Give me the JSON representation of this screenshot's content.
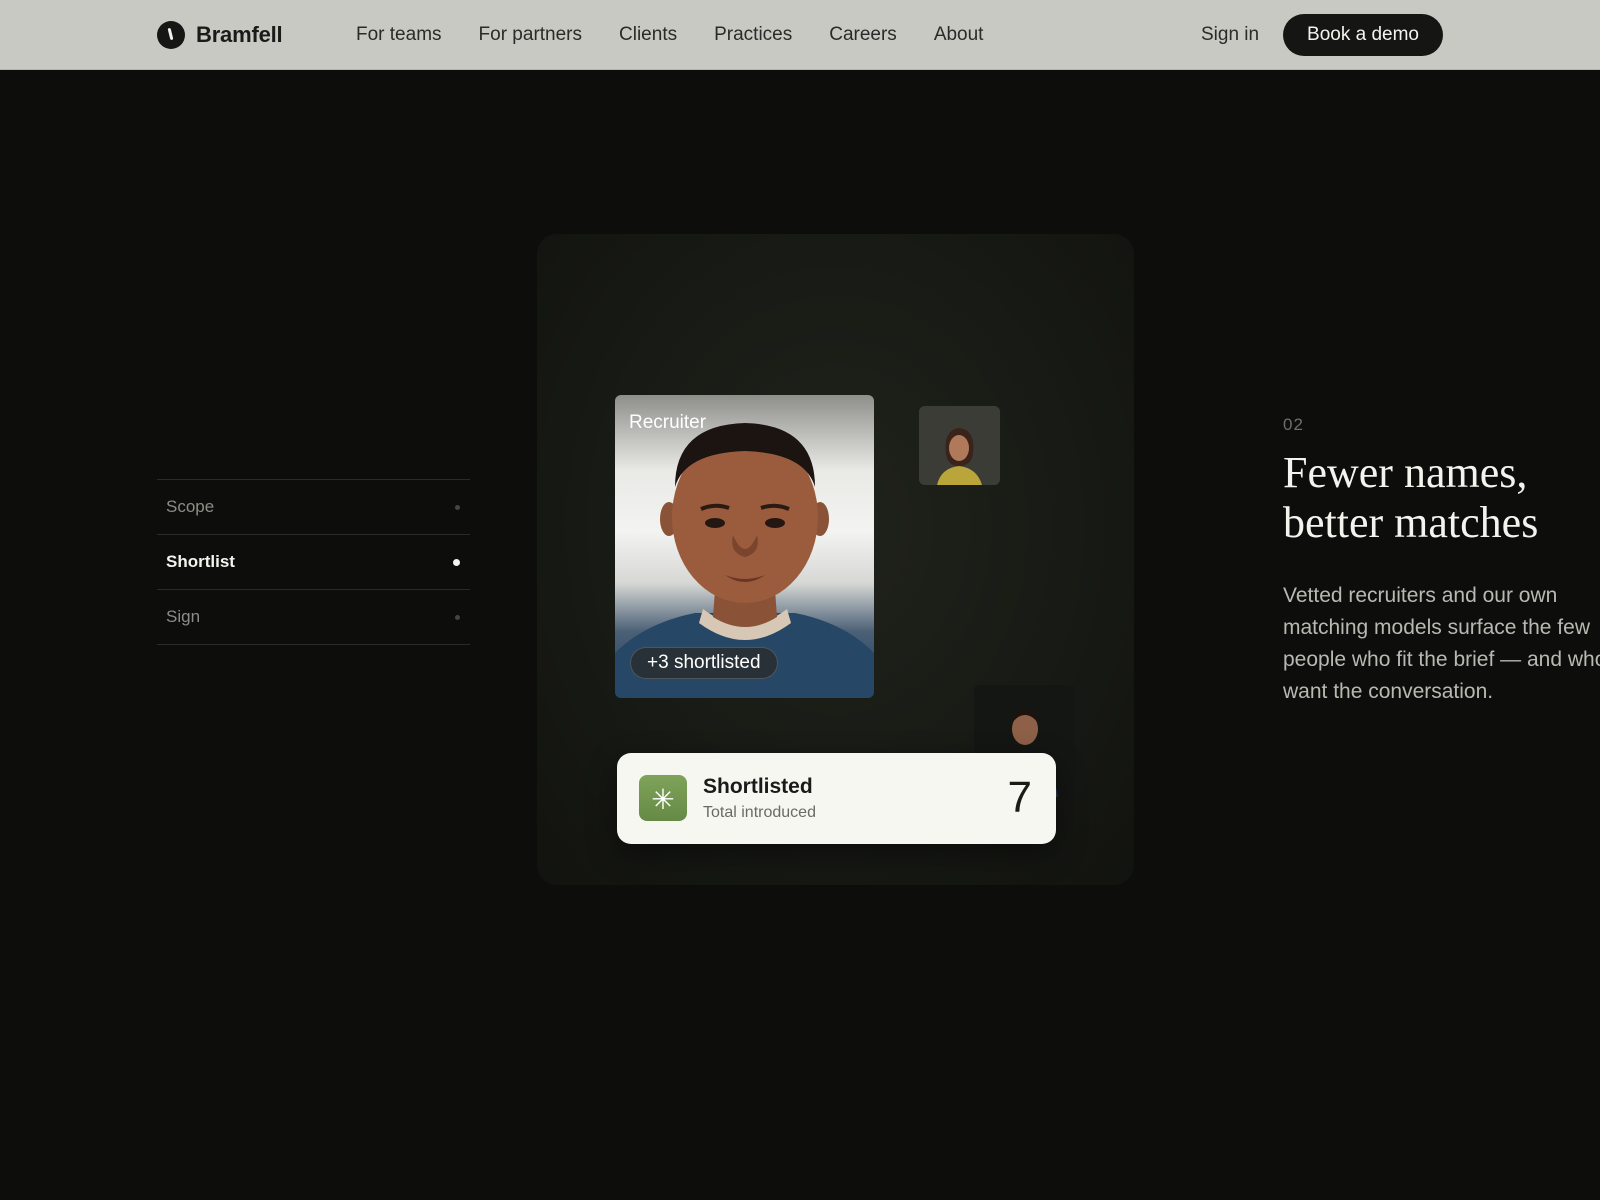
{
  "brand": {
    "name": "Bramfell"
  },
  "nav": {
    "items": [
      "For teams",
      "For partners",
      "Clients",
      "Practices",
      "Careers",
      "About"
    ],
    "sign_in": "Sign in",
    "cta": "Book a demo"
  },
  "steps": [
    {
      "label": "Scope",
      "active": false
    },
    {
      "label": "Shortlist",
      "active": true
    },
    {
      "label": "Sign",
      "active": false
    }
  ],
  "stage": {
    "profile": {
      "tag": "Recruiter",
      "pill": "+3 shortlisted"
    },
    "stat": {
      "icon": "asterisk-icon",
      "title": "Shortlisted",
      "subtitle": "Total introduced",
      "value": "7"
    }
  },
  "section": {
    "number": "02",
    "headline_line1": "Fewer names,",
    "headline_line2": "better matches",
    "body_lines": [
      "Vetted recruiters and our own",
      "matching models surface the few",
      "people who fit the brief — and who",
      "want the conversation."
    ]
  },
  "colors": {
    "background": "#0d0e0c",
    "topbar": "#c9c9c4",
    "cta_background": "#151613",
    "accent_green": "#6f9550"
  }
}
